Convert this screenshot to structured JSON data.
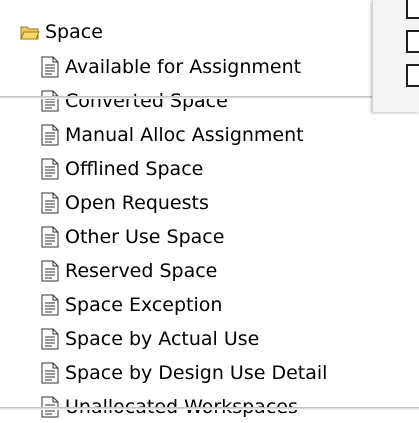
{
  "tree": {
    "root": {
      "label": "Space",
      "icon": "folder-open-icon"
    },
    "items": [
      {
        "label": "Available for Assignment",
        "icon": "document-icon"
      },
      {
        "label": "Converted Space",
        "icon": "document-icon"
      },
      {
        "label": "Manual Alloc Assignment",
        "icon": "document-icon"
      },
      {
        "label": "Offlined Space",
        "icon": "document-icon"
      },
      {
        "label": "Open Requests",
        "icon": "document-icon"
      },
      {
        "label": "Other Use Space",
        "icon": "document-icon"
      },
      {
        "label": "Reserved Space",
        "icon": "document-icon"
      },
      {
        "label": "Space Exception",
        "icon": "document-icon"
      },
      {
        "label": "Space by Actual Use",
        "icon": "document-icon"
      },
      {
        "label": "Space by Design Use Detail",
        "icon": "document-icon"
      },
      {
        "label": "Unallocated Workspaces",
        "icon": "document-icon"
      }
    ]
  },
  "colors": {
    "folder": "#f2c94c",
    "folder_border": "#9a7a1a",
    "document": "#ffffff",
    "document_border": "#333333"
  }
}
